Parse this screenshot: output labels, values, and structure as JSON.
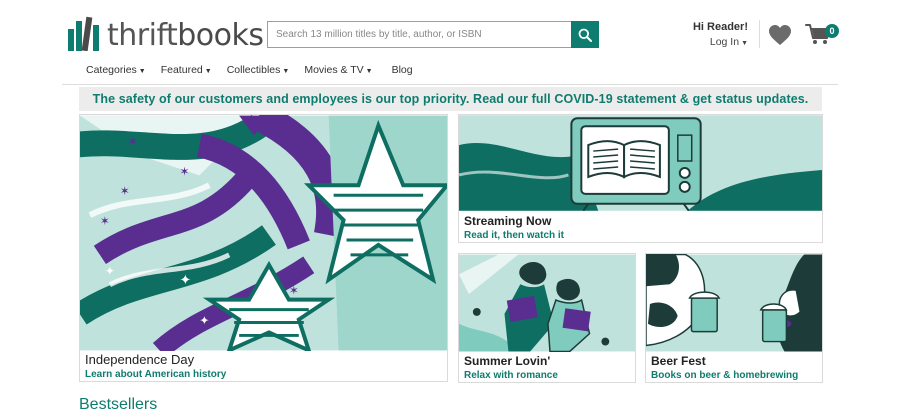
{
  "brand": {
    "thrift": "thrift",
    "books": "books"
  },
  "search": {
    "placeholder": "Search 13 million titles by title, author, or ISBN"
  },
  "account": {
    "greeting": "Hi Reader!",
    "login": "Log In"
  },
  "cart": {
    "count": "0"
  },
  "nav": [
    {
      "label": "Categories"
    },
    {
      "label": "Featured"
    },
    {
      "label": "Collectibles"
    },
    {
      "label": "Movies & TV"
    },
    {
      "label": "Blog"
    }
  ],
  "banner": {
    "text": "The safety of our customers and employees is our top priority. Read our full COVID-19 statement & get status updates."
  },
  "tiles": {
    "independence": {
      "title": "Independence Day",
      "subtitle": "Learn about American history"
    },
    "streaming": {
      "title": "Streaming Now",
      "subtitle": "Read it, then watch it"
    },
    "summer": {
      "title": "Summer Lovin'",
      "subtitle": "Relax with romance"
    },
    "beer": {
      "title": "Beer Fest",
      "subtitle": "Books on beer & homebrewing"
    }
  },
  "sections": {
    "bestsellers": "Bestsellers"
  },
  "colors": {
    "brand_teal": "#0e7c6e",
    "banner_bg": "#ececec",
    "tile_teal": "#7fcbbd",
    "purple": "#5a2d91"
  },
  "icons": [
    "search-icon",
    "heart-icon",
    "cart-icon",
    "chevron-down-icon"
  ]
}
